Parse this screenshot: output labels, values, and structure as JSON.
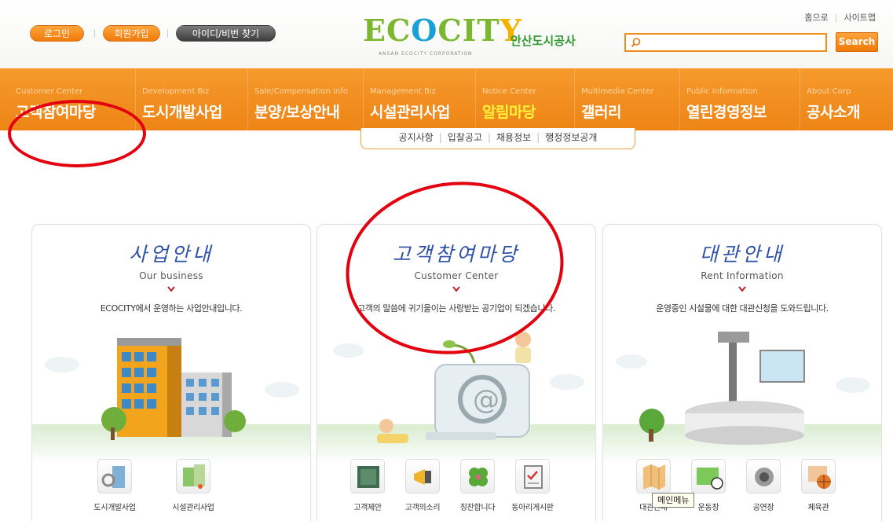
{
  "header": {
    "login_label": "로그인",
    "join_label": "회원가입",
    "find_id_label": "아이디/비번 찾기",
    "home_link": "홈으로",
    "sitemap_link": "사이트맵",
    "search": {
      "value": "",
      "placeholder": "",
      "button_label": "Search"
    },
    "logo": {
      "brand": "ECOCITY",
      "korean": "안산도시공사",
      "sub": "ANSAN ECOCITY CORPORATION"
    }
  },
  "nav": {
    "items": [
      {
        "en": "Customer Center",
        "ko": "고객참여마당"
      },
      {
        "en": "Development Biz",
        "ko": "도시개발사업"
      },
      {
        "en": "Sale/Compensation info",
        "ko": "분양/보상안내"
      },
      {
        "en": "Management Biz",
        "ko": "시설관리사업"
      },
      {
        "en": "Notice Center",
        "ko": "알림마당"
      },
      {
        "en": "Multimedia Center",
        "ko": "갤러리"
      },
      {
        "en": "Public Information",
        "ko": "열린경영정보"
      },
      {
        "en": "About Corp",
        "ko": "공사소개"
      }
    ],
    "active_index": 4
  },
  "submenu": {
    "items": [
      "공지사항",
      "입찰공고",
      "채용정보",
      "행정정보공개"
    ]
  },
  "cards": [
    {
      "title": "사업안내",
      "subtitle": "Our business",
      "description": "ECOCITY에서 운영하는 사업안내입니다.",
      "links": [
        "도시개발사업",
        "시설관리사업"
      ]
    },
    {
      "title": "고객참여마당",
      "subtitle": "Customer Center",
      "description": "고객의 말씀에 귀기울이는 사랑받는 공기업이 되겠습니다.",
      "links": [
        "고객제안",
        "고객의소리",
        "칭찬합니다",
        "동아리게시판"
      ]
    },
    {
      "title": "대관안내",
      "subtitle": "Rent Information",
      "description": "운영중인 시설물에 대한 대관신청을 도와드립니다.",
      "links": [
        "대관안내",
        "운동장",
        "공연장",
        "체육관"
      ]
    }
  ],
  "tooltip": "메인메뉴",
  "colors": {
    "accent_orange": "#f08c1a",
    "title_blue": "#2e52a8",
    "annotation_red": "#e3000f"
  }
}
